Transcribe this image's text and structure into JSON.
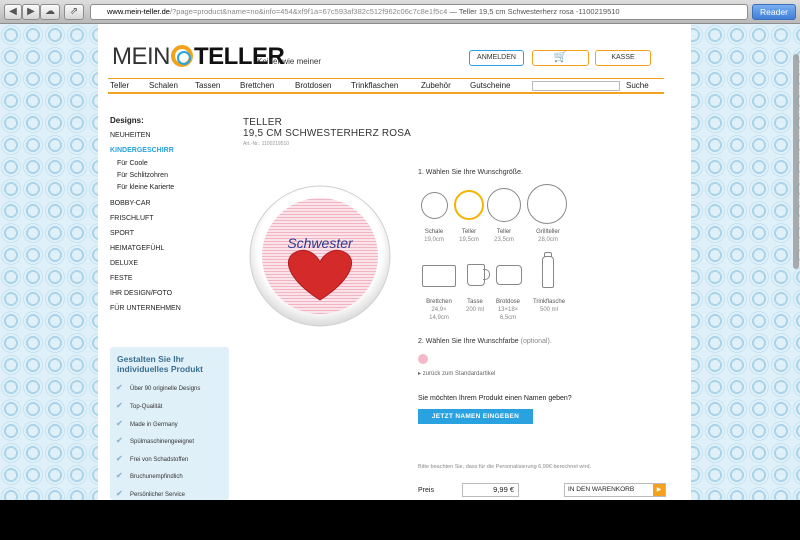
{
  "browser": {
    "url_host": "www.mein-teller.de",
    "url_rest": "/?page=product&name=no&info=454&xf9f1a=67c593af382c512f962c06c7c8e1f5c4",
    "page_title_sep": "—",
    "page_title": "Teller 19,5 cm Schwesterherz rosa -1100219510",
    "reader_label": "Reader",
    "back_icon": "back-arrow-icon",
    "forward_icon": "forward-arrow-icon"
  },
  "header": {
    "logo_mein": "MEIN",
    "logo_teller": "TELLER",
    "tagline": "Keiner wie meiner",
    "login_label": "ANMELDEN",
    "cart_icon": "🛒",
    "kasse_label": "KASSE"
  },
  "nav": {
    "items": [
      "Teller",
      "Schalen",
      "Tassen",
      "Brettchen",
      "Brotdosen",
      "Trinkflaschen",
      "Zubehör",
      "Gutscheine"
    ],
    "search_label": "Suche",
    "search_value": ""
  },
  "sidebar": {
    "title": "Designs:",
    "categories": [
      "NEUHEITEN",
      "KINDERGESCHIRR",
      "Für Coole",
      "Für Schlitzohren",
      "Für kleine Karierte",
      "BOBBY-CAR",
      "FRISCHLUFT",
      "SPORT",
      "HEIMATGEFÜHL",
      "DELUXE",
      "FESTE",
      "IHR DESIGN/FOTO",
      "FÜR UNTERNEHMEN"
    ],
    "infobox_title": "Gestalten Sie Ihr individuelles Produkt",
    "features": [
      "Über 90 originelle Designs",
      "Top-Qualität",
      "Made in Germany",
      "Spülmaschinengeeignet",
      "Frei von Schadstoffen",
      "Bruchunempfindlich",
      "Persönlicher Service"
    ]
  },
  "product": {
    "category": "TELLER",
    "name": "19,5 CM SCHWESTERHERZ ROSA",
    "artnr": "Art.-Nr.: 1100219510",
    "plate_text": "Schwester",
    "step1_label": "1. Wählen Sie Ihre Wunschgröße.",
    "sizes": [
      {
        "name": "Schale",
        "dim": "19,0cm"
      },
      {
        "name": "Teller",
        "dim": "19,5cm"
      },
      {
        "name": "Teller",
        "dim": "23,5cm"
      },
      {
        "name": "Grillteller",
        "dim": "28,0cm"
      }
    ],
    "products": [
      {
        "name": "Brettchen",
        "dim": "24,9×",
        "dim2": "14,9cm"
      },
      {
        "name": "Tasse",
        "dim": "200 ml",
        "dim2": ""
      },
      {
        "name": "Brotdose",
        "dim": "13×18×",
        "dim2": "6,5cm"
      },
      {
        "name": "Trinkflasche",
        "dim": "500 ml",
        "dim2": ""
      }
    ],
    "step2_label": "2. Wählen Sie Ihre Wunschfarbe",
    "step2_optional": "(optional).",
    "selected_color": "#f5b8c8",
    "reset_link": "zurück zum Standardartikel",
    "name_question": "Sie möchten Ihrem Produkt einen Namen geben?",
    "name_button": "JETZT NAMEN EINGEBEN",
    "note": "Bitte beachten Sie, dass für die Personalisierung 6,99€ berechnet wird.",
    "price_label": "Preis",
    "price_value": "9,99 €",
    "cart_button": "IN DEN WARENKORB"
  },
  "colors": {
    "accent_blue": "#2aa2e0",
    "accent_orange": "#f4a21e",
    "heart_red": "#d42a2a",
    "plate_pink": "#f7c9d4"
  }
}
